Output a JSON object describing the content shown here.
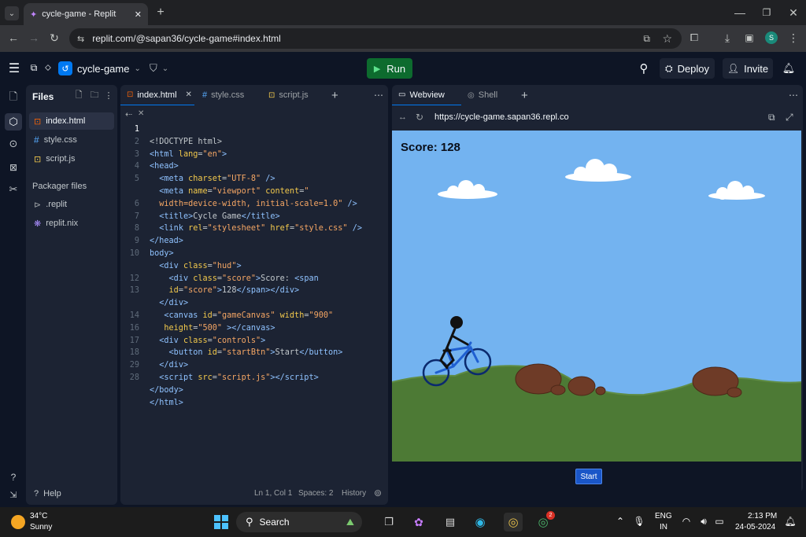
{
  "browser": {
    "tab_title": "cycle-game - Replit",
    "url": "replit.com/@sapan36/cycle-game#index.html",
    "profile_initial": "S"
  },
  "header": {
    "project_name": "cycle-game",
    "run_label": "Run",
    "deploy_label": "Deploy",
    "invite_label": "Invite"
  },
  "files": {
    "title": "Files",
    "items": [
      "index.html",
      "style.css",
      "script.js"
    ],
    "packager_title": "Packager files",
    "packager_items": [
      ".replit",
      "replit.nix"
    ],
    "help_label": "Help"
  },
  "editor": {
    "tabs": [
      "index.html",
      "style.css",
      "script.js"
    ],
    "line_numbers": [
      "1",
      "2",
      "3",
      "4",
      "5",
      "",
      "6",
      "7",
      "8",
      "9",
      "10",
      "",
      "12",
      "13",
      "",
      "14",
      "16",
      "17",
      "18",
      "29",
      "28"
    ],
    "status": {
      "position": "Ln 1, Col 1",
      "spaces": "Spaces: 2",
      "history": "History"
    }
  },
  "webview": {
    "tabs": [
      "Webview",
      "Shell"
    ],
    "url": "https://cycle-game.sapan36.repl.co",
    "score_text": "Score: 128",
    "start_label": "Start"
  },
  "taskbar": {
    "weather_temp": "34°C",
    "weather_desc": "Sunny",
    "search_label": "Search",
    "lang_top": "ENG",
    "lang_bottom": "IN",
    "time": "2:13 PM",
    "date": "24-05-2024",
    "notification_badge": "2"
  },
  "colors": {
    "run_green": "#0d6b2e",
    "sky": "#73b3f0",
    "grass": "#4d7a35",
    "start_blue": "#1a56c8",
    "accent": "#0079f2"
  }
}
